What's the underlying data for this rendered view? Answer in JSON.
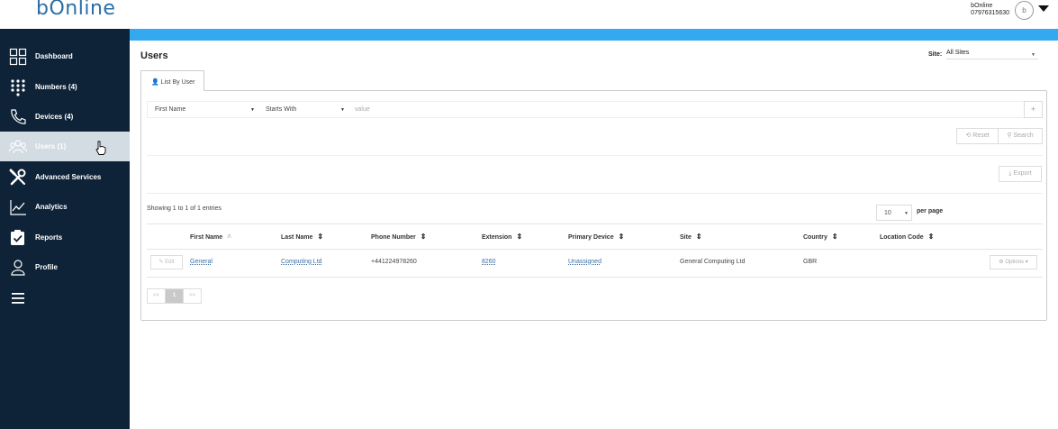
{
  "brand": {
    "logo_text": "bOnline",
    "accent": "#33a9ef",
    "sidebar_bg": "#0e2338"
  },
  "account": {
    "name": "bOnline",
    "phone": "07976315630",
    "avatar_letter": "b"
  },
  "sidebar": {
    "items": [
      {
        "label": "Dashboard",
        "icon": "grid-icon"
      },
      {
        "label": "Numbers (4)",
        "icon": "keypad-icon"
      },
      {
        "label": "Devices (4)",
        "icon": "phone-icon"
      },
      {
        "label": "Users (1)",
        "icon": "users-icon",
        "active": true
      },
      {
        "label": "Advanced Services",
        "icon": "tools-icon"
      },
      {
        "label": "Analytics",
        "icon": "chart-line-icon"
      },
      {
        "label": "Reports",
        "icon": "checkbox-icon"
      },
      {
        "label": "Profile",
        "icon": "person-icon"
      }
    ],
    "menu_icon": "hamburger-icon"
  },
  "page": {
    "title": "Users",
    "site_label": "Site:",
    "site_value": "All Sites",
    "tab_label": "List By User"
  },
  "filter": {
    "field": "First Name",
    "operator": "Starts With",
    "value_placeholder": "value",
    "add_label": "+",
    "reset_label": "Reset",
    "search_label": "Search",
    "export_label": "Export"
  },
  "table": {
    "showing": "Showing 1 to 1 of 1 entries",
    "per_page_value": "10",
    "per_page_label": "per page",
    "columns": [
      "First Name",
      "Last Name",
      "Phone Number",
      "Extension",
      "Primary Device",
      "Site",
      "Country",
      "Location Code"
    ],
    "rows": [
      {
        "edit_label": "Edit",
        "first_name": "General",
        "last_name": "Computing Ltd",
        "phone": "+441224978260",
        "extension": "8260",
        "primary_device": "Unassigned",
        "site": "General Computing Ltd",
        "country": "GBR",
        "location_code": "",
        "options_label": "Options"
      }
    ]
  },
  "pagination": {
    "prev": "<<",
    "current": "1",
    "next": ">>"
  }
}
